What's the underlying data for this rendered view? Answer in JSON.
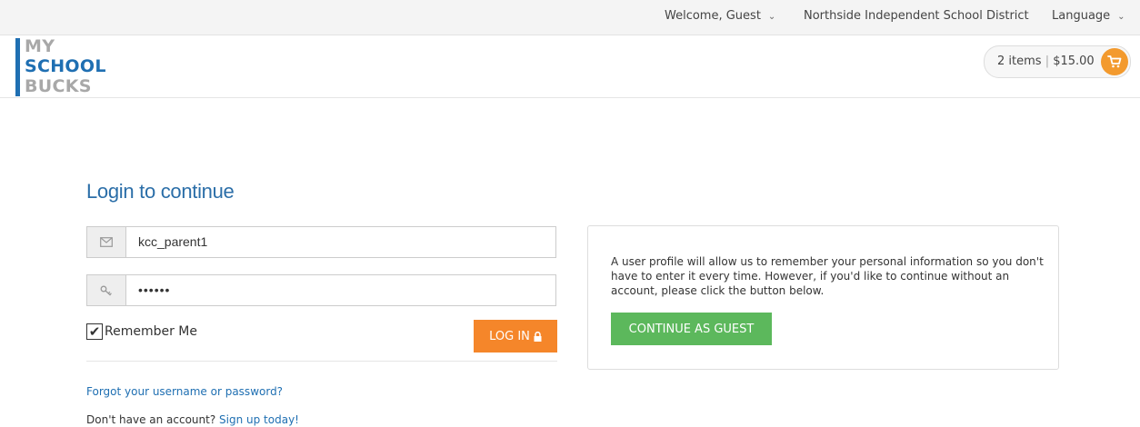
{
  "topbar": {
    "welcome": "Welcome, Guest",
    "district": "Northside Independent School District",
    "language": "Language"
  },
  "logo": {
    "line1": "MY",
    "line2": "SCHOOL",
    "line3": "BUCKS"
  },
  "cart": {
    "items": "2 items",
    "separator": "|",
    "total": "$15.00"
  },
  "login": {
    "title": "Login to continue",
    "username_value": "kcc_parent1",
    "password_value": "••••••",
    "remember_label": "Remember Me",
    "remember_checked": true,
    "login_button": "LOG IN",
    "forgot_link": "Forgot your username or password?",
    "no_account_text": "Don't have an account? ",
    "signup_link": "Sign up today!"
  },
  "guest": {
    "description": "A user profile will allow us to remember your personal information so you don't have to enter it every time. However, if you'd like to continue without an account, please click the button below.",
    "button": "CONTINUE AS GUEST"
  },
  "colors": {
    "brand_blue": "#1f6fb2",
    "accent_orange": "#f5862a",
    "guest_green": "#5cb85c"
  },
  "icons": {
    "email": "envelope-icon",
    "password": "key-icon",
    "login": "lock-icon",
    "cart": "shopping-cart-icon",
    "dropdown": "chevron-down-icon"
  }
}
